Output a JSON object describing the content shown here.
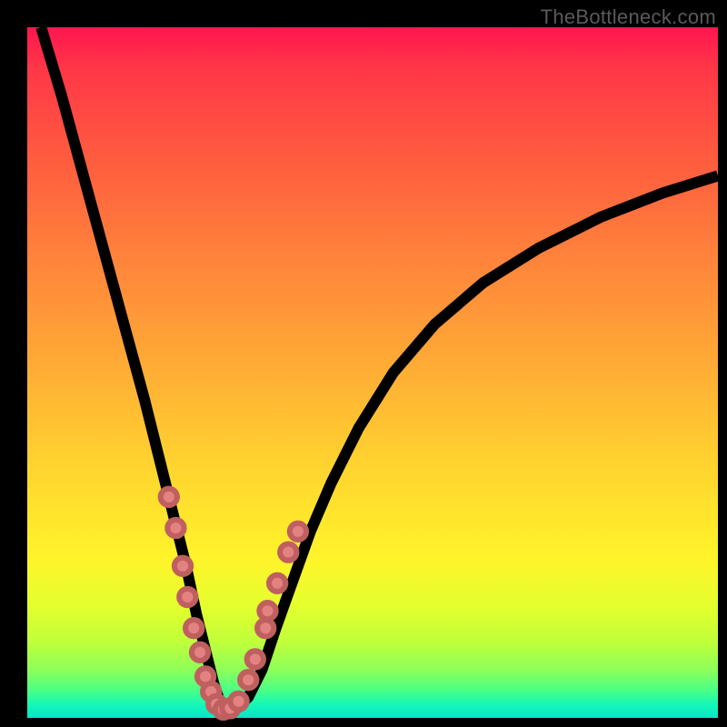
{
  "watermark": "TheBottleneck.com",
  "colors": {
    "background": "#000000",
    "gradient_top": "#ff154f",
    "gradient_bottom": "#07e6c8",
    "curve_stroke": "#000000",
    "marker_fill": "#e48282",
    "marker_stroke": "#c05f5f"
  },
  "chart_data": {
    "type": "line",
    "title": "",
    "xlabel": "",
    "ylabel": "",
    "xlim": [
      0,
      100
    ],
    "ylim": [
      0,
      100
    ],
    "series": [
      {
        "name": "bottleneck-curve",
        "x": [
          2,
          5,
          8,
          11,
          14,
          17,
          19,
          21,
          23,
          24.5,
          26,
          27,
          28,
          29,
          30.5,
          32,
          34,
          36,
          38.5,
          41,
          44,
          48,
          53,
          59,
          66,
          74,
          83,
          92,
          100
        ],
        "y": [
          100,
          90,
          79,
          68,
          57,
          46,
          38,
          30,
          22,
          15,
          9,
          5,
          2,
          1,
          1.5,
          3,
          7,
          13,
          20,
          27,
          34,
          42,
          50,
          57,
          63,
          68,
          72.5,
          76,
          78.5
        ]
      }
    ],
    "markers": {
      "name": "sample-points",
      "x": [
        20.5,
        21.5,
        22.5,
        23.2,
        24.1,
        25.0,
        25.8,
        26.6,
        27.4,
        28.4,
        29.4,
        30.6,
        32.0,
        33.0,
        34.5,
        34.8,
        36.2,
        37.8,
        39.2
      ],
      "y": [
        32.0,
        27.5,
        22.0,
        17.5,
        13.0,
        9.5,
        6.0,
        3.8,
        2.0,
        1.2,
        1.4,
        2.4,
        5.5,
        8.5,
        13.0,
        15.5,
        19.5,
        24.0,
        27.0
      ],
      "radius": 1.2
    }
  }
}
